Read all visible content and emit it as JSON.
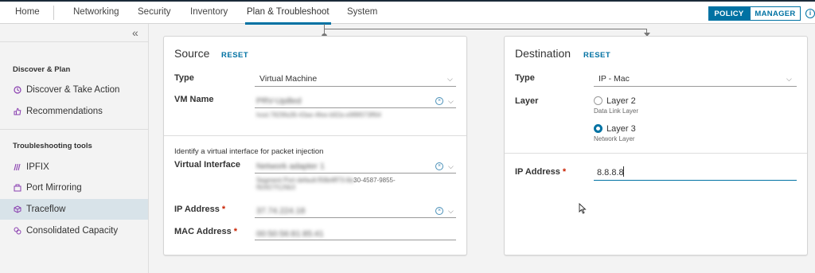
{
  "nav": {
    "tabs": [
      {
        "label": "Home"
      },
      {
        "label": "Networking"
      },
      {
        "label": "Security"
      },
      {
        "label": "Inventory"
      },
      {
        "label": "Plan & Troubleshoot"
      },
      {
        "label": "System"
      }
    ],
    "mode_policy": "POLICY",
    "mode_manager": "MANAGER",
    "info_glyph": "i"
  },
  "sidebar": {
    "collapse_glyph": "«",
    "section1": "Discover & Plan",
    "section2": "Troubleshooting tools",
    "items": [
      {
        "label": "Discover & Take Action",
        "icon": "discover-icon"
      },
      {
        "label": "Recommendations",
        "icon": "recommendations-icon"
      },
      {
        "label": "IPFIX",
        "icon": "ipfix-icon"
      },
      {
        "label": "Port Mirroring",
        "icon": "port-mirroring-icon"
      },
      {
        "label": "Traceflow",
        "icon": "traceflow-icon"
      },
      {
        "label": "Consolidated Capacity",
        "icon": "capacity-icon"
      }
    ]
  },
  "source": {
    "title": "Source",
    "reset": "RESET",
    "type_label": "Type",
    "type_value": "Virtual Machine",
    "vm_label": "VM Name",
    "vm_value": "PRV-Upilled",
    "vm_sub": "host:7829fa36-43ae-4fee-b92a-e9f8f073ff64",
    "hint": "Identify a virtual interface for packet injection",
    "vif_label": "Virtual Interface",
    "vif_value": "Network adapter 1",
    "vif_sub_blur": "Segment Port default:f59b4ff73-8a",
    "vif_sub_clear": "30-4587-9855-",
    "vif_sub_2": "f92827f126b3",
    "ip_label": "IP Address",
    "ip_value": "37.74.224.18",
    "mac_label": "MAC Address",
    "mac_value": "00:50:56:81:85:41",
    "required_mark": "*"
  },
  "destination": {
    "title": "Destination",
    "reset": "RESET",
    "type_label": "Type",
    "type_value": "IP - Mac",
    "layer_label": "Layer",
    "layer2_label": "Layer 2",
    "layer2_sub": "Data Link Layer",
    "layer3_label": "Layer 3",
    "layer3_sub": "Network Layer",
    "selected_layer": "Layer 3",
    "ip_label": "IP Address",
    "ip_value": "8.8.8.8",
    "required_mark": "*"
  },
  "colors": {
    "accent": "#0072a3",
    "required": "#c92100"
  }
}
